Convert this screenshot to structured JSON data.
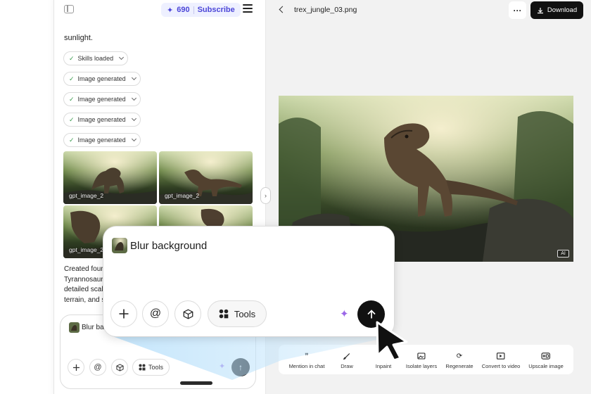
{
  "header": {
    "credits": "690",
    "subscribe_label": "Subscribe"
  },
  "chat": {
    "message_tail": "sunlight.",
    "chips": [
      {
        "label": "Skills loaded"
      },
      {
        "label": "Image generated"
      },
      {
        "label": "Image generated"
      },
      {
        "label": "Image generated"
      },
      {
        "label": "Image generated"
      }
    ],
    "thumbnails": [
      {
        "label": "gpt_image_2"
      },
      {
        "label": "gpt_image_2"
      },
      {
        "label": "gpt_image_2"
      },
      {
        "label": ""
      }
    ],
    "created_lines": [
      "Created four",
      "Tyrannosaur",
      "detailed scal",
      "terrain, and s"
    ]
  },
  "composer_small": {
    "attachment_text": "Blur bac",
    "tools_label": "Tools"
  },
  "viewer": {
    "filename": "trex_jungle_03.png",
    "more_label": "···",
    "download_label": "Download",
    "ai_badge": "AI"
  },
  "toolbar": [
    {
      "label": "Mention in chat",
      "icon": "quote-icon"
    },
    {
      "label": "Draw",
      "icon": "brush-icon"
    },
    {
      "label": "Inpaint",
      "icon": "inpaint-icon"
    },
    {
      "label": "Isolate layers",
      "icon": "layers-icon"
    },
    {
      "label": "Regenerate",
      "icon": "refresh-icon"
    },
    {
      "label": "Convert to video",
      "icon": "video-icon"
    },
    {
      "label": "Upscale image",
      "icon": "hd-icon"
    }
  ],
  "composer_big": {
    "attachment_text": "Blur background",
    "tools_label": "Tools"
  },
  "colors": {
    "accent": "#4c46d8",
    "accent_bg": "#eef0ff",
    "spark": "#9b67e8",
    "send": "#111111"
  }
}
